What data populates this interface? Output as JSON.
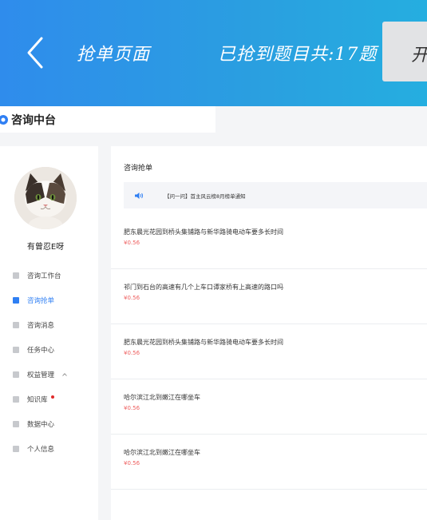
{
  "header": {
    "title": "抢单页面",
    "count_text": "已抢到题目共:17题",
    "start_label": "开"
  },
  "brand": {
    "name": "咨询中台"
  },
  "user": {
    "name": "有曾忍E呀"
  },
  "sidebar": {
    "items": [
      {
        "label": "咨询工作台"
      },
      {
        "label": "咨询抢单"
      },
      {
        "label": "咨询消息"
      },
      {
        "label": "任务中心"
      },
      {
        "label": "权益管理"
      },
      {
        "label": "知识库"
      },
      {
        "label": "数据中心"
      },
      {
        "label": "个人信息"
      }
    ]
  },
  "main": {
    "title": "咨询抢单",
    "notice": "【问一问】首主风云榜8月榜单通知",
    "questions": [
      {
        "text": "肥东晨光花园到桥头集铺路与新华路骑电动车要多长时间",
        "price": "¥0.56"
      },
      {
        "text": "祁门到石台的高速有几个上车口谭家桥有上高速的路口吗",
        "price": "¥0.56"
      },
      {
        "text": "肥东晨光花园到桥头集铺路与新华路骑电动车要多长时间",
        "price": "¥0.56"
      },
      {
        "text": "哈尔滨江北到嫩江在哪坐车",
        "price": "¥0.56"
      },
      {
        "text": "哈尔滨江北到嫩江在哪坐车",
        "price": "¥0.56"
      }
    ]
  },
  "colors": {
    "accent": "#2f7ff3",
    "banner_start": "#2f8cec",
    "banner_end": "#25aee0",
    "price": "#ee5f5f",
    "badge": "#e02a2a"
  }
}
